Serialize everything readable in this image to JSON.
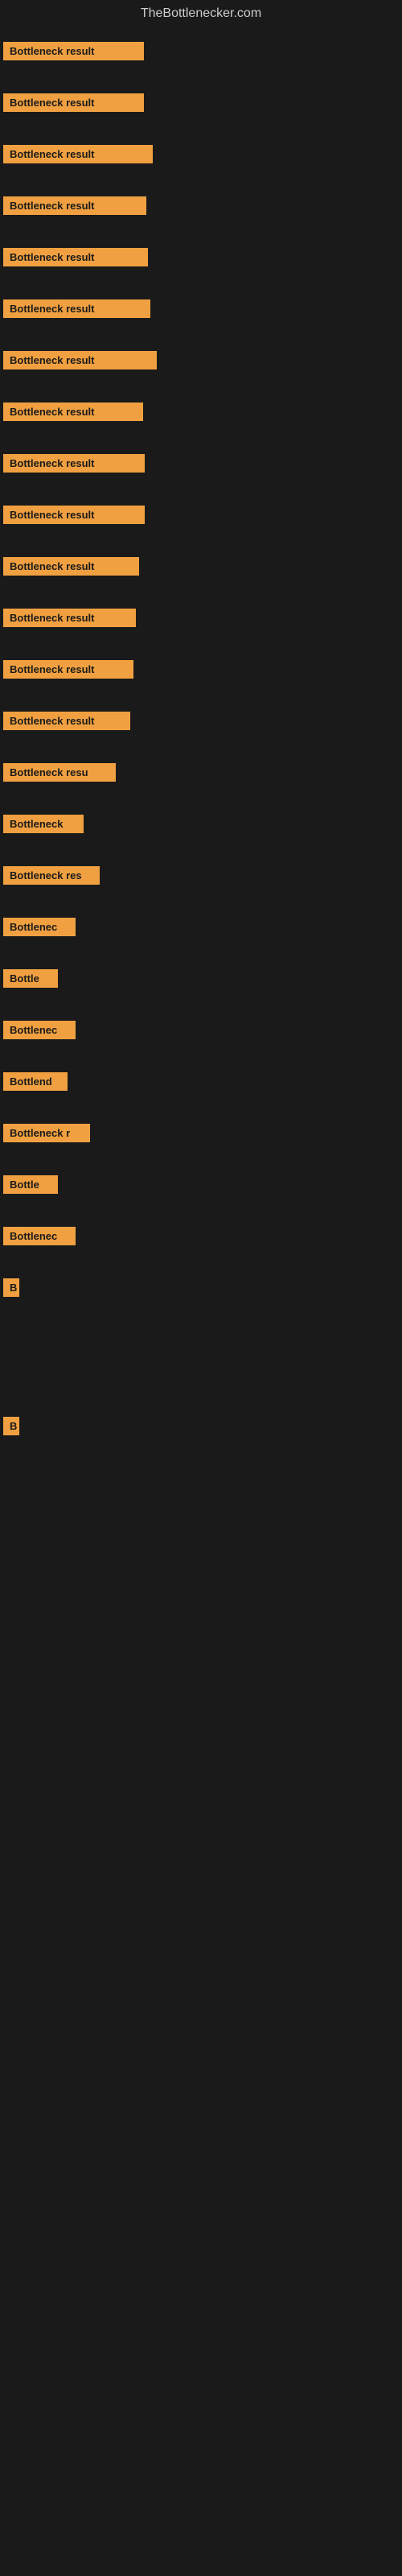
{
  "site": {
    "title": "TheBottlenecker.com"
  },
  "rows": [
    {
      "id": 1,
      "label": "Bottleneck result",
      "width": 175
    },
    {
      "id": 2,
      "label": "Bottleneck result",
      "width": 175
    },
    {
      "id": 3,
      "label": "Bottleneck result",
      "width": 186
    },
    {
      "id": 4,
      "label": "Bottleneck result",
      "width": 178
    },
    {
      "id": 5,
      "label": "Bottleneck result",
      "width": 180
    },
    {
      "id": 6,
      "label": "Bottleneck result",
      "width": 183
    },
    {
      "id": 7,
      "label": "Bottleneck result",
      "width": 191
    },
    {
      "id": 8,
      "label": "Bottleneck result",
      "width": 174
    },
    {
      "id": 9,
      "label": "Bottleneck result",
      "width": 176
    },
    {
      "id": 10,
      "label": "Bottleneck result",
      "width": 176
    },
    {
      "id": 11,
      "label": "Bottleneck result",
      "width": 169
    },
    {
      "id": 12,
      "label": "Bottleneck result",
      "width": 165
    },
    {
      "id": 13,
      "label": "Bottleneck result",
      "width": 162
    },
    {
      "id": 14,
      "label": "Bottleneck result",
      "width": 158
    },
    {
      "id": 15,
      "label": "Bottleneck resu",
      "width": 140
    },
    {
      "id": 16,
      "label": "Bottleneck",
      "width": 100
    },
    {
      "id": 17,
      "label": "Bottleneck res",
      "width": 120
    },
    {
      "id": 18,
      "label": "Bottlenec",
      "width": 90
    },
    {
      "id": 19,
      "label": "Bottle",
      "width": 68
    },
    {
      "id": 20,
      "label": "Bottlenec",
      "width": 90
    },
    {
      "id": 21,
      "label": "Bottlend",
      "width": 80
    },
    {
      "id": 22,
      "label": "Bottleneck r",
      "width": 108
    },
    {
      "id": 23,
      "label": "Bottle",
      "width": 68
    },
    {
      "id": 24,
      "label": "Bottlenec",
      "width": 90
    },
    {
      "id": 25,
      "label": "B",
      "width": 20
    },
    {
      "id": 26,
      "label": "",
      "width": 0
    },
    {
      "id": 27,
      "label": "",
      "width": 0
    },
    {
      "id": 28,
      "label": "",
      "width": 0
    },
    {
      "id": 29,
      "label": "B",
      "width": 20
    },
    {
      "id": 30,
      "label": "",
      "width": 0
    },
    {
      "id": 31,
      "label": "",
      "width": 0
    },
    {
      "id": 32,
      "label": "",
      "width": 0
    },
    {
      "id": 33,
      "label": "",
      "width": 0
    }
  ],
  "colors": {
    "accent": "#f0a040",
    "background": "#1a1a1a",
    "text": "#cccccc"
  }
}
